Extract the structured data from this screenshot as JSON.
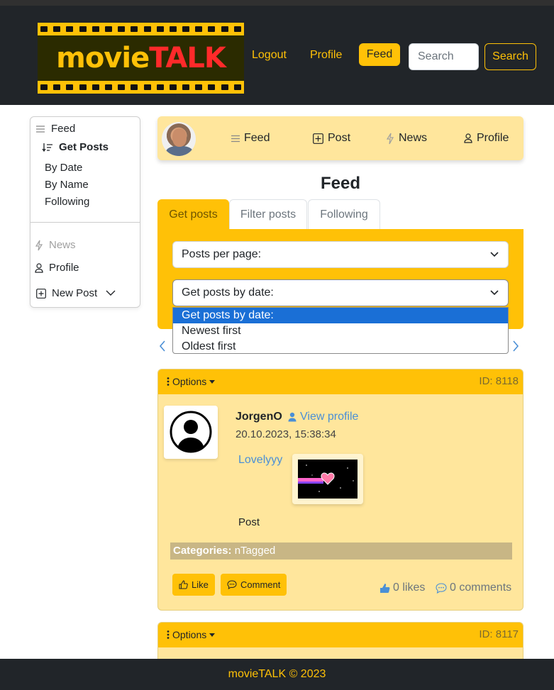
{
  "header": {
    "logo_part1": "movie",
    "logo_part2": "TALK",
    "nav": [
      "Logout",
      "Profile"
    ],
    "feed_button": "Feed",
    "search_placeholder": "Search",
    "search_button": "Search",
    "colors": {
      "accent": "#ffc107",
      "dark": "#212529"
    }
  },
  "sidebar": {
    "feed": "Feed",
    "get_posts": "Get Posts",
    "sub_items": [
      "By Date",
      "By Name",
      "Following"
    ],
    "news": "News",
    "profile": "Profile",
    "new_post": "New Post"
  },
  "profile_bar": {
    "items": [
      "Feed",
      "Post",
      "News",
      "Profile"
    ]
  },
  "main": {
    "title": "Feed",
    "tabs": [
      "Get posts",
      "Filter posts",
      "Following"
    ],
    "select_per_page": "Posts per page:",
    "select_by_date": "Get posts by date:",
    "dropdown_options": [
      "Get posts by date:",
      "Newest first",
      "Oldest first"
    ]
  },
  "posts": [
    {
      "options_label": "Options",
      "id_label": "ID: 8118",
      "author": "JorgenO",
      "view_profile": "View profile",
      "date": "20.10.2023, 15:38:34",
      "link_text": "Lovelyyy",
      "body": "Post",
      "categories_label": "Categories:",
      "categories_value": "nTagged",
      "like_label": "Like",
      "comment_label": "Comment",
      "likes": "0 likes",
      "comments": "0 comments"
    },
    {
      "options_label": "Options",
      "id_label": "ID: 8117"
    }
  ],
  "footer": {
    "text": "movieTALK © 2023"
  }
}
